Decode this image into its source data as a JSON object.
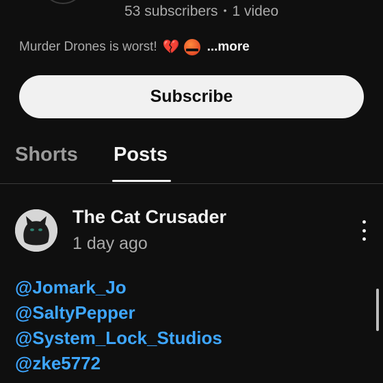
{
  "channel": {
    "subscribers": "53 subscribers",
    "separator": "•",
    "videos": "1 video",
    "description": "Murder Drones is worst!",
    "description_emojis": [
      "broken-heart",
      "angry-face-with-symbols"
    ],
    "more_label": "...more"
  },
  "subscribe_label": "Subscribe",
  "tabs": [
    {
      "label": "Shorts",
      "selected": false
    },
    {
      "label": "Posts",
      "selected": true
    }
  ],
  "post": {
    "author": "The Cat Crusader",
    "time": "1 day ago",
    "mentions": [
      "@Jomark_Jo",
      "@SaltyPepper",
      "@System_Lock_Studios",
      "@zke5772"
    ]
  },
  "colors": {
    "background": "#0f0f0f",
    "mention": "#3ea6ff",
    "button": "#f1f1f1"
  }
}
